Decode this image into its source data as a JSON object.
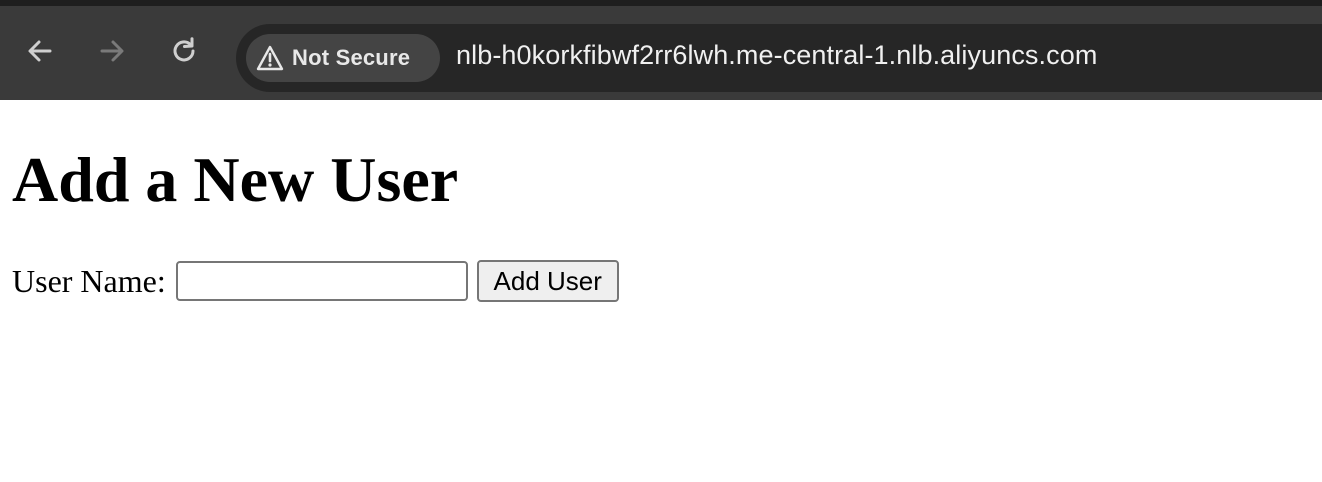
{
  "browser": {
    "security_label": "Not Secure",
    "url": "nlb-h0korkfibwf2rr6lwh.me-central-1.nlb.aliyuncs.com",
    "icons": {
      "back": "arrow-left-icon",
      "forward": "arrow-right-icon",
      "reload": "reload-icon",
      "security": "warning-triangle-icon"
    },
    "colors": {
      "toolbar": "#3a3a3a",
      "omnibox": "#262626",
      "chip": "#444444"
    }
  },
  "page": {
    "heading": "Add a New User",
    "form": {
      "label": "User Name:",
      "input_value": "",
      "submit_label": "Add User"
    }
  }
}
